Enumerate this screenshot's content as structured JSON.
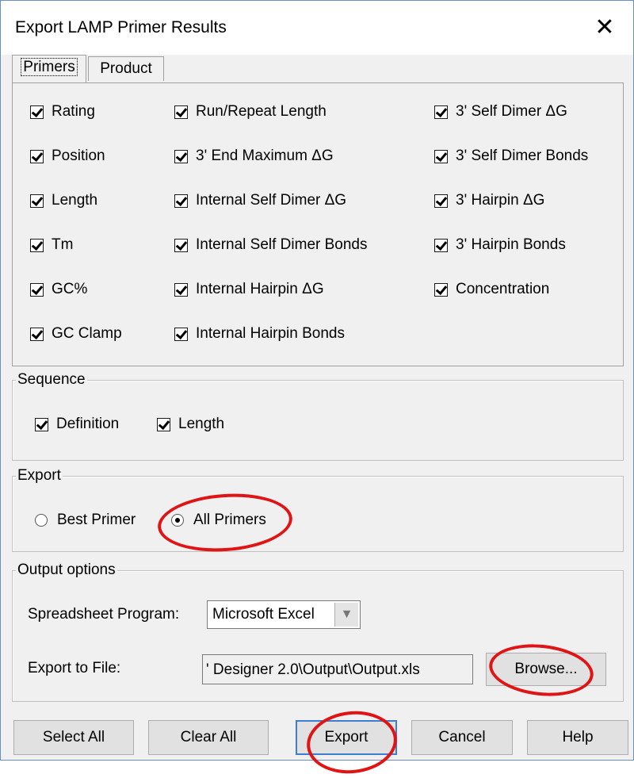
{
  "window": {
    "title": "Export LAMP Primer Results",
    "close_symbol": "✕"
  },
  "tabs": [
    {
      "label": "Primers",
      "active": true
    },
    {
      "label": "Product",
      "active": false
    }
  ],
  "primers": {
    "col1": [
      {
        "label": "Rating",
        "checked": true
      },
      {
        "label": "Position",
        "checked": true
      },
      {
        "label": "Length",
        "checked": true
      },
      {
        "label": "Tm",
        "checked": true
      },
      {
        "label": "GC%",
        "checked": true
      },
      {
        "label": "GC Clamp",
        "checked": true
      }
    ],
    "col2": [
      {
        "label": "Run/Repeat Length",
        "checked": true
      },
      {
        "label": "3' End Maximum ΔG",
        "checked": true
      },
      {
        "label": "Internal Self Dimer ΔG",
        "checked": true
      },
      {
        "label": "Internal Self Dimer Bonds",
        "checked": true
      },
      {
        "label": "Internal Hairpin ΔG",
        "checked": true
      },
      {
        "label": "Internal Hairpin Bonds",
        "checked": true
      }
    ],
    "col3": [
      {
        "label": "3' Self Dimer ΔG",
        "checked": true
      },
      {
        "label": "3' Self Dimer Bonds",
        "checked": true
      },
      {
        "label": "3' Hairpin ΔG",
        "checked": true
      },
      {
        "label": "3' Hairpin Bonds",
        "checked": true
      },
      {
        "label": "Concentration",
        "checked": true
      }
    ]
  },
  "sequence": {
    "legend": "Sequence",
    "items": [
      {
        "label": "Definition",
        "checked": true
      },
      {
        "label": "Length",
        "checked": true
      }
    ]
  },
  "export": {
    "legend": "Export",
    "options": [
      {
        "label": "Best Primer",
        "selected": false
      },
      {
        "label": "All Primers",
        "selected": true
      }
    ]
  },
  "output": {
    "legend": "Output options",
    "spreadsheet_label": "Spreadsheet Program:",
    "spreadsheet_value": "Microsoft Excel",
    "file_label": "Export to File:",
    "file_value": "' Designer 2.0\\Output\\Output.xls",
    "browse_label": "Browse..."
  },
  "buttons": {
    "select_all": "Select All",
    "clear_all": "Clear All",
    "export": "Export",
    "cancel": "Cancel",
    "help": "Help"
  },
  "icons": {
    "close": "close-icon",
    "dropdown": "chevron-down-icon"
  },
  "colors": {
    "window_bg": "#f0f0f0",
    "accent": "#3c7fd2",
    "annotation": "#e01414"
  }
}
